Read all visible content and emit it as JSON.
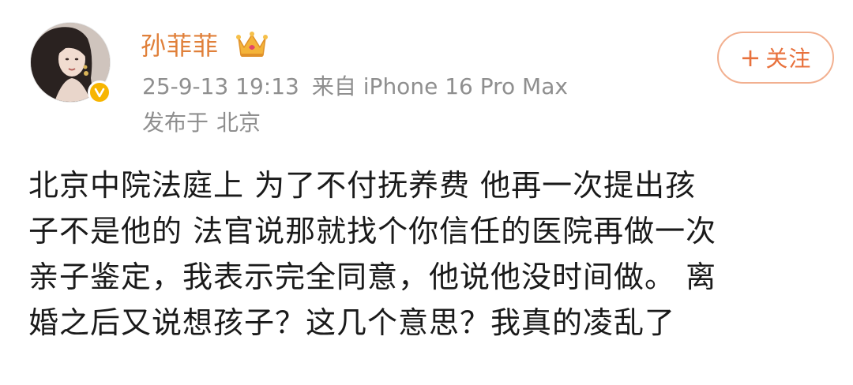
{
  "author": {
    "name": "孙菲菲",
    "avatar_icon": "avatar-image",
    "verified_badge_icon": "verified-v-icon",
    "verified_badge_color": "#f7b500",
    "crown_icon": "crown-icon",
    "name_color": "#e0803a"
  },
  "meta": {
    "timestamp": "25-9-13 19:13",
    "source": "来自 iPhone 16 Pro Max",
    "location_prefix": "发布于",
    "location": "北京"
  },
  "follow_button": {
    "icon": "plus-icon",
    "plus_glyph": "+",
    "label": "关注",
    "accent_color": "#e8713c"
  },
  "post": {
    "lines": [
      "北京中院法庭上 为了不付抚养费 他再一次提出孩",
      "子不是他的 法官说那就找个你信任的医院再做一次",
      "亲子鉴定，我表示完全同意，他说他没时间做。 离",
      "婚之后又说想孩子？这几个意思？我真的凌乱了"
    ]
  }
}
